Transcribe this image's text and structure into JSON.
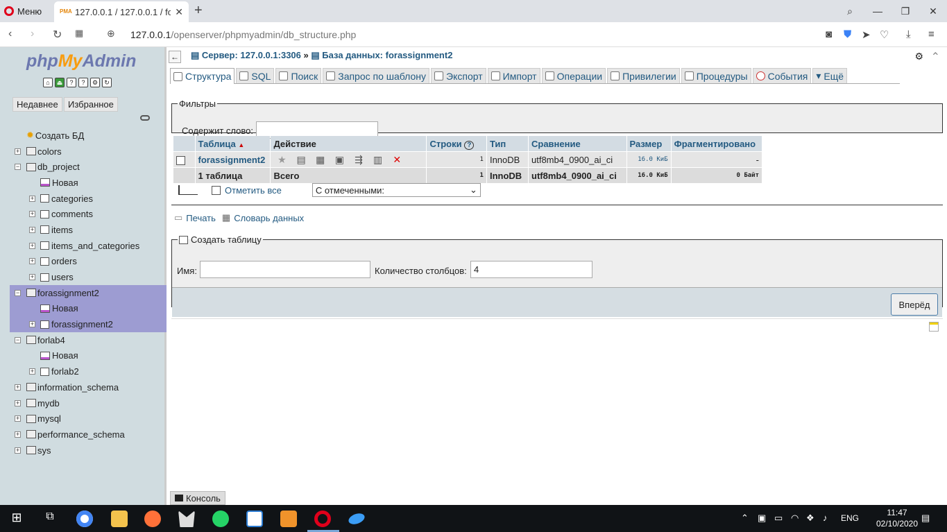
{
  "browser": {
    "menu_label": "Меню",
    "tab_title": "127.0.0.1 / 127.0.0.1 / forassignment2",
    "url_host": "127.0.0.1",
    "url_path": "/openserver/phpmyadmin/db_structure.php"
  },
  "nav": {
    "logo_php": "php",
    "logo_my": "My",
    "logo_admin": "Admin",
    "recent": "Недавнее",
    "favorites": "Избранное",
    "tree": [
      {
        "label": "Создать БД"
      },
      {
        "label": "colors"
      },
      {
        "label": "db_project"
      },
      {
        "label": "Новая"
      },
      {
        "label": "categories"
      },
      {
        "label": "comments"
      },
      {
        "label": "items"
      },
      {
        "label": "items_and_categories"
      },
      {
        "label": "orders"
      },
      {
        "label": "users"
      },
      {
        "label": "forassignment2"
      },
      {
        "label": "Новая"
      },
      {
        "label": "forassignment2"
      },
      {
        "label": "forlab4"
      },
      {
        "label": "Новая"
      },
      {
        "label": "forlab2"
      },
      {
        "label": "information_schema"
      },
      {
        "label": "mydb"
      },
      {
        "label": "mysql"
      },
      {
        "label": "performance_schema"
      },
      {
        "label": "sys"
      }
    ]
  },
  "main": {
    "breadcrumb_server": "Сервер: 127.0.0.1:3306",
    "breadcrumb_sep": "»",
    "breadcrumb_db": "База данных: forassignment2",
    "tabs": [
      {
        "label": "Структура"
      },
      {
        "label": "SQL"
      },
      {
        "label": "Поиск"
      },
      {
        "label": "Запрос по шаблону"
      },
      {
        "label": "Экспорт"
      },
      {
        "label": "Импорт"
      },
      {
        "label": "Операции"
      },
      {
        "label": "Привилегии"
      },
      {
        "label": "Процедуры"
      },
      {
        "label": "События"
      },
      {
        "label": "Ещё"
      }
    ],
    "filters": {
      "legend": "Фильтры",
      "label": "Содержит слово:",
      "value": ""
    },
    "table": {
      "headers": [
        "Таблица",
        "Действие",
        "Строки",
        "Тип",
        "Сравнение",
        "Размер",
        "Фрагментировано"
      ],
      "rows": [
        {
          "name": "forassignment2",
          "rows": "1",
          "type": "InnoDB",
          "collation": "utf8mb4_0900_ai_ci",
          "size": "16.0 КиБ",
          "overhead": "-"
        }
      ],
      "summary": {
        "name": "1 таблица",
        "action": "Всего",
        "rows": "1",
        "type": "InnoDB",
        "collation": "utf8mb4_0900_ai_ci",
        "size": "16.0 КиБ",
        "overhead": "0 Байт"
      }
    },
    "check_all": "Отметить все",
    "with_selected": "С отмеченными:",
    "print": "Печать",
    "data_dictionary": "Словарь данных",
    "create": {
      "legend": "Создать таблицу",
      "name_label": "Имя:",
      "name_value": "",
      "cols_label": "Количество столбцов:",
      "cols_value": "4",
      "go": "Вперёд"
    },
    "console": "Консоль"
  },
  "taskbar": {
    "lang": "ENG",
    "time": "11:47",
    "date": "02/10/2020"
  }
}
